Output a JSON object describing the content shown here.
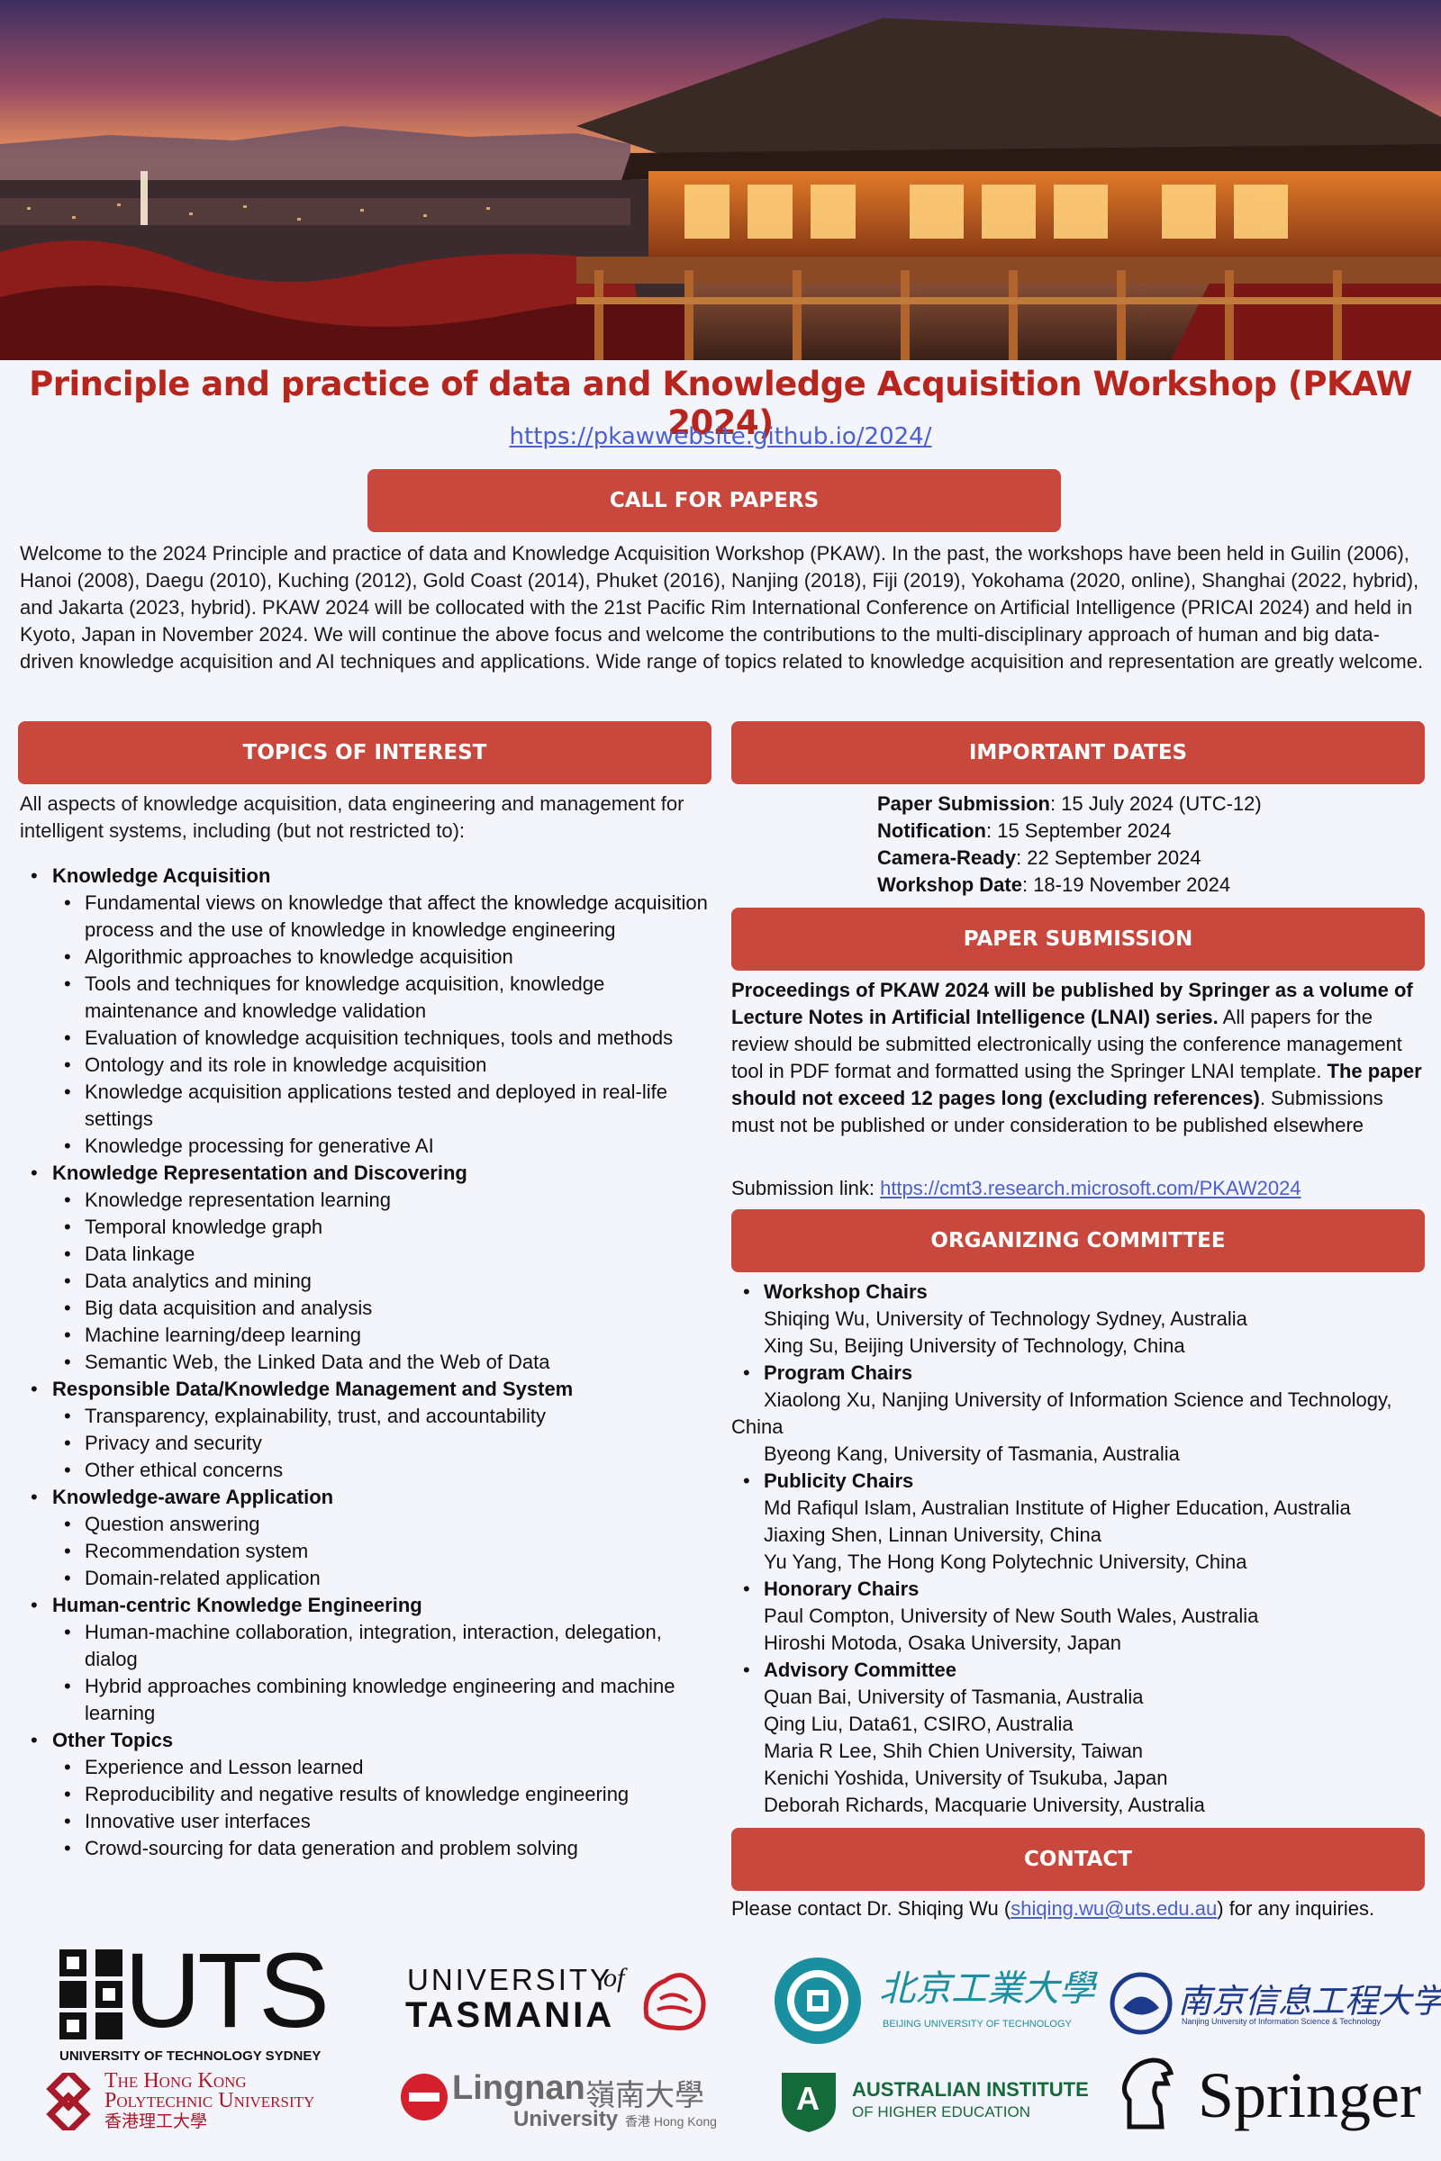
{
  "header": {
    "title": "Principle and practice of data and Knowledge Acquisition Workshop (PKAW 2024)",
    "url": "https://pkawwebsite.github.io/2024/"
  },
  "banners": {
    "call": "CALL FOR PAPERS",
    "topics": "TOPICS OF INTEREST",
    "dates": "IMPORTANT DATES",
    "submission": "PAPER SUBMISSION",
    "committee": "ORGANIZING COMMITTEE",
    "contact": "CONTACT"
  },
  "intro": "Welcome to the 2024 Principle and practice of data and Knowledge Acquisition Workshop (PKAW). In the past, the workshops have been held in Guilin (2006), Hanoi (2008), Daegu (2010), Kuching (2012), Gold Coast (2014), Phuket (2016), Nanjing (2018), Fiji (2019), Yokohama (2020, online), Shanghai (2022, hybrid), and Jakarta (2023, hybrid). PKAW 2024 will be collocated with the 21st Pacific Rim International Conference on Artificial Intelligence (PRICAI 2024) and held in Kyoto, Japan in November 2024. We will continue the above focus and welcome the contributions to the multi-disciplinary approach of human and big data-driven knowledge acquisition and AI techniques and applications. Wide range of topics related to knowledge acquisition and representation are greatly welcome.",
  "topics": {
    "intro": "All aspects of knowledge acquisition, data engineering and management for intelligent systems, including (but not restricted to):",
    "categories": [
      {
        "name": "Knowledge Acquisition",
        "items": [
          "Fundamental views on knowledge that affect the knowledge acquisition process and the use of knowledge in knowledge engineering",
          "Algorithmic approaches to knowledge acquisition",
          "Tools and techniques for knowledge acquisition, knowledge maintenance and knowledge validation",
          "Evaluation of knowledge acquisition techniques, tools and methods",
          "Ontology and its role in knowledge acquisition",
          "Knowledge acquisition applications tested and deployed in real-life settings",
          "Knowledge processing for generative AI"
        ]
      },
      {
        "name": "Knowledge Representation and Discovering",
        "items": [
          "Knowledge representation learning",
          "Temporal knowledge graph",
          "Data linkage",
          "Data analytics and mining",
          "Big data acquisition and analysis",
          "Machine learning/deep learning",
          "Semantic Web, the Linked Data and the Web of Data"
        ]
      },
      {
        "name": "Responsible Data/Knowledge Management and System",
        "items": [
          "Transparency, explainability, trust, and accountability",
          "Privacy and security",
          "Other ethical concerns"
        ]
      },
      {
        "name": "Knowledge-aware Application",
        "items": [
          "Question answering",
          "Recommendation system",
          "Domain-related application"
        ]
      },
      {
        "name": "Human-centric Knowledge Engineering",
        "items": [
          "Human-machine collaboration, integration, interaction, delegation, dialog",
          "Hybrid approaches combining knowledge engineering and machine learning"
        ]
      },
      {
        "name": "Other Topics",
        "items": [
          "Experience and Lesson learned",
          "Reproducibility and negative results of knowledge engineering",
          "Innovative user interfaces",
          "Crowd-sourcing for data generation and problem solving"
        ]
      }
    ]
  },
  "dates": [
    {
      "label": "Paper Submission",
      "value": ": 15 July 2024 (UTC-12)"
    },
    {
      "label": "Notification",
      "value": ": 15 September 2024"
    },
    {
      "label": "Camera-Ready",
      "value": ": 22 September 2024"
    },
    {
      "label": "Workshop Date",
      "value": ": 18-19 November 2024"
    }
  ],
  "submission": {
    "bold1": "Proceedings of PKAW 2024 will be published by Springer as a volume of Lecture Notes in Artificial Intelligence (LNAI) series.",
    "text1": " All papers for the review should be submitted electronically using the conference management tool in PDF format and formatted using the Springer LNAI template. ",
    "bold2": "The paper should not exceed 12 pages long (excluding references)",
    "text2": ". Submissions must not be published or under consideration to be published elsewhere",
    "link_label": "Submission link: ",
    "link": "https://cmt3.research.microsoft.com/PKAW2024"
  },
  "committee": [
    {
      "role": "Workshop Chairs",
      "members": [
        "Shiqing Wu, University of Technology Sydney, Australia",
        "Xing Su, Beijing University of Technology, China"
      ]
    },
    {
      "role": "Program Chairs",
      "members": [
        "Xiaolong Xu, Nanjing University of Information Science and Technology, China",
        "Byeong Kang, University of Tasmania, Australia"
      ]
    },
    {
      "role": "Publicity Chairs",
      "members": [
        "Md Rafiqul Islam, Australian Institute of Higher Education, Australia",
        "Jiaxing Shen, Linnan University, China",
        "Yu Yang, The Hong Kong Polytechnic University, China"
      ]
    },
    {
      "role": "Honorary Chairs",
      "members": [
        "Paul Compton, University of New South Wales, Australia",
        "Hiroshi Motoda, Osaka University, Japan"
      ]
    },
    {
      "role": "Advisory Committee",
      "members": [
        "Quan Bai, University of Tasmania, Australia",
        "Qing Liu, Data61, CSIRO, Australia",
        "Maria R Lee, Shih Chien University, Taiwan",
        "Kenichi Yoshida, University of Tsukuba, Japan",
        "Deborah Richards, Macquarie University, Australia"
      ]
    }
  ],
  "contact": {
    "pre": "Please contact Dr. Shiqing Wu (",
    "email": "shiqing.wu@uts.edu.au",
    "post": ") for any inquiries."
  },
  "logos": {
    "uts": "UTS",
    "uts_sub": "UNIVERSITY OF TECHNOLOGY SYDNEY",
    "tas_top": "UNIVERSITY",
    "tas_of": "of",
    "tas_bottom": "TASMANIA",
    "bjut_cn": "北京工業大學",
    "bjut_en": "BEIJING UNIVERSITY OF TECHNOLOGY",
    "nuist_cn": "南京信息工程大学",
    "nuist_en": "Nanjing University of Information Science & Technology",
    "polyu_1": "The Hong Kong",
    "polyu_2": "Polytechnic University",
    "polyu_cn": "香港理工大學",
    "lingnan": "Lingnan",
    "lingnan_cn": "嶺南大學",
    "lingnan_univ": "University",
    "lingnan_hk": "香港 Hong Kong",
    "aihe_1": "AUSTRALIAN INSTITUTE",
    "aihe_2": "OF HIGHER EDUCATION",
    "aihe_letter": "A",
    "springer": "Springer"
  }
}
